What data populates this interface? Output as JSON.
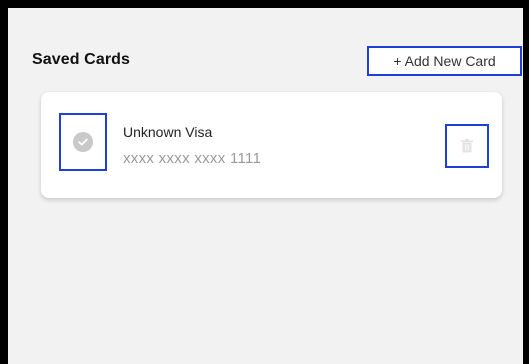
{
  "header": {
    "title": "Saved Cards",
    "add_button_label": "+ Add New Card"
  },
  "cards": [
    {
      "name": "Unknown Visa",
      "number": "xxxx xxxx xxxx 1111",
      "selected_icon": "check-circle-icon",
      "delete_icon": "trash-icon"
    }
  ],
  "colors": {
    "highlight_border": "#1f3fd6",
    "background": "#f2f2f2",
    "card_background": "#ffffff",
    "muted_text": "#9a9a9a"
  }
}
